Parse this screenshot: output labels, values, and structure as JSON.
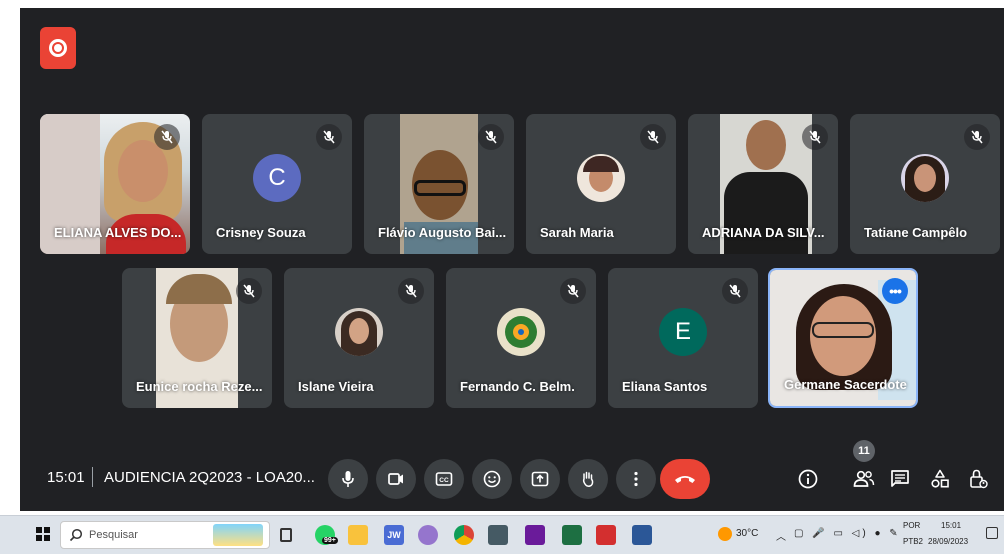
{
  "meeting": {
    "time": "15:01",
    "title": "AUDIENCIA 2Q2023 - LOA20...",
    "participant_count": "11",
    "initials": {
      "crisney": "C",
      "eliana_santos": "E"
    }
  },
  "participants": {
    "p1": "ELIANA ALVES DO...",
    "p2": "Crisney Souza",
    "p3": "Flávio Augusto Bai...",
    "p4": "Sarah Maria",
    "p5": "ADRIANA DA SILV...",
    "p6": "Tatiane Campêlo",
    "p7": "Eunice rocha Reze...",
    "p8": "Islane Vieira",
    "p9": "Fernando C. Belm.",
    "p10": "Eliana Santos",
    "p11": "Germane Sacerdote"
  },
  "colors": {
    "recording": "#ea4335",
    "end_call": "#ea4335",
    "active_border": "#8ab4f8",
    "avatar_c": "#5c6bc0",
    "avatar_e": "#00695c"
  },
  "taskbar": {
    "search_placeholder": "Pesquisar",
    "whatsapp_badge": "99+",
    "jw_label": "JW",
    "weather": "30°C",
    "lang_top": "POR",
    "lang_bottom": "PTB2",
    "clock_time": "15:01",
    "clock_date": "28/09/2023"
  }
}
